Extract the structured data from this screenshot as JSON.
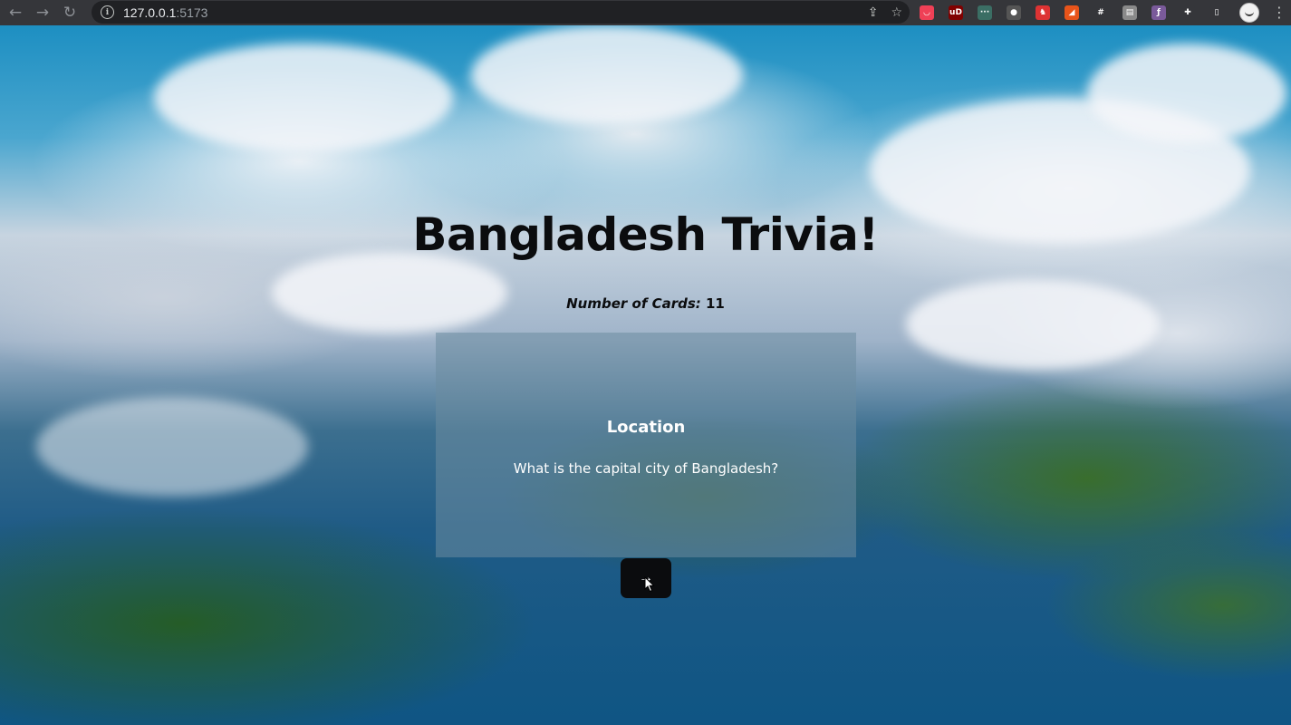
{
  "browser": {
    "url_host": "127.0.0.1",
    "url_port": ":5173",
    "extensions": [
      {
        "name": "pocket-icon",
        "color": "#ef4056",
        "glyph": "◡"
      },
      {
        "name": "ublock-icon",
        "color": "#800000",
        "glyph": "uD"
      },
      {
        "name": "dots-extension-icon",
        "color": "#3b6e64",
        "glyph": "···"
      },
      {
        "name": "flask-extension-icon",
        "color": "#555555",
        "glyph": "●"
      },
      {
        "name": "shield-extension-icon",
        "color": "#d33",
        "glyph": "♞"
      },
      {
        "name": "wave-extension-icon",
        "color": "#e8541a",
        "glyph": "◢"
      },
      {
        "name": "hash-extension-icon",
        "color": "#35363a",
        "glyph": "#"
      },
      {
        "name": "notes-extension-icon",
        "color": "#8a8a8a",
        "glyph": "▤"
      },
      {
        "name": "feather-extension-icon",
        "color": "#7a5a9a",
        "glyph": "ƒ"
      },
      {
        "name": "puzzle-extensions-icon",
        "color": "#35363a",
        "glyph": "✚"
      },
      {
        "name": "sidepanel-icon",
        "color": "#35363a",
        "glyph": "▯"
      }
    ]
  },
  "app": {
    "title": "Bangladesh Trivia!",
    "card_count_label": "Number of Cards:",
    "card_count_value": "11",
    "card": {
      "category": "Location",
      "question": "What is the capital city of Bangladesh?"
    },
    "next_button_glyph": "→"
  }
}
